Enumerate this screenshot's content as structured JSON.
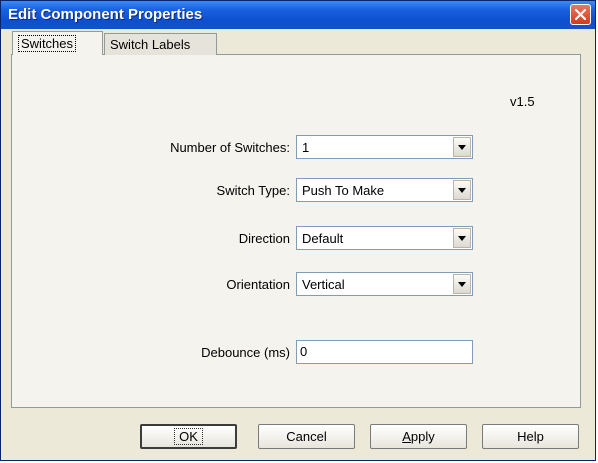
{
  "window": {
    "title": "Edit Component Properties"
  },
  "tabs": [
    {
      "label": "Switches",
      "active": true
    },
    {
      "label": "Switch Labels",
      "active": false
    }
  ],
  "version": "v1.5",
  "fields": {
    "num_switches": {
      "label": "Number of Switches:",
      "value": "1"
    },
    "switch_type": {
      "label": "Switch Type:",
      "value": "Push To Make"
    },
    "direction": {
      "label": "Direction",
      "value": "Default"
    },
    "orientation": {
      "label": "Orientation",
      "value": "Vertical"
    },
    "debounce": {
      "label": "Debounce (ms)",
      "value": "0"
    }
  },
  "buttons": {
    "ok": "OK",
    "cancel": "Cancel",
    "apply": "Apply",
    "help": "Help"
  },
  "icons": {
    "close": "close-icon",
    "dropdown": "chevron-down-icon"
  },
  "colors": {
    "titlebar": "#0d4fd1",
    "close_button": "#cf3d1b",
    "dialog_bg": "#ece9d8"
  }
}
